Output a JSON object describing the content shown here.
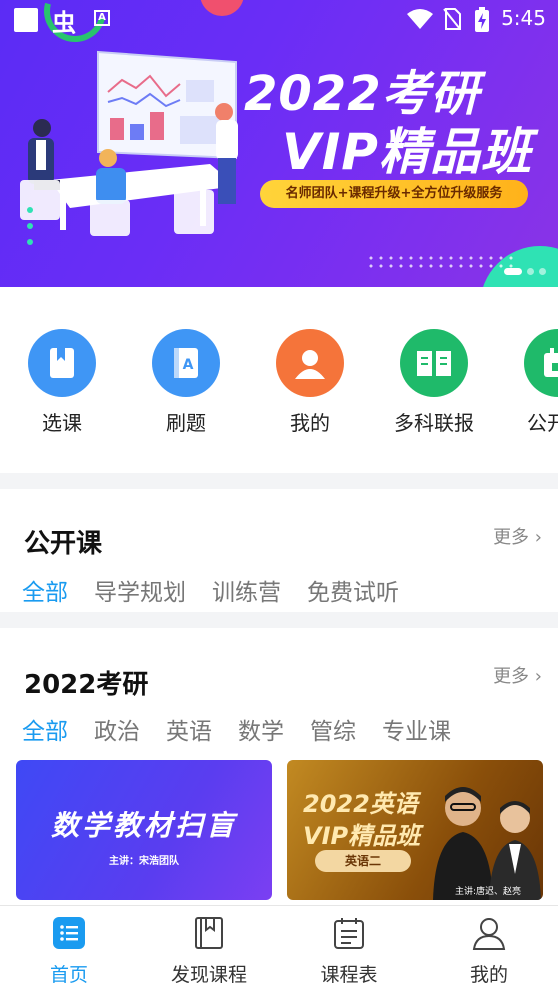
{
  "status_bar": {
    "time": "5:45"
  },
  "banner": {
    "title_line1": "2022考研",
    "title_line2": "VIP精品班",
    "tagline": "名师团队+课程升级+全方位升级服务",
    "colors": {
      "bg": "#6a2df6",
      "pill": "#ffc52a"
    }
  },
  "quick_nav": [
    {
      "label": "选课",
      "icon": "book-icon",
      "color": "#3f96f5"
    },
    {
      "label": "刷题",
      "icon": "exercise-book-icon",
      "color": "#3f96f5"
    },
    {
      "label": "我的",
      "icon": "user-icon",
      "color": "#f5743a"
    },
    {
      "label": "多科联报",
      "icon": "open-book-icon",
      "color": "#1fba6a"
    },
    {
      "label": "公开",
      "icon": "calendar-icon",
      "color": "#1fba6a"
    }
  ],
  "open_courses": {
    "title": "公开课",
    "more": "更多",
    "tabs": [
      "全部",
      "导学规划",
      "训练营",
      "免费试听"
    ]
  },
  "exam2022": {
    "title": "2022考研",
    "more": "更多",
    "tabs": [
      "全部",
      "政治",
      "英语",
      "数学",
      "管综",
      "专业课"
    ],
    "cards": [
      {
        "title": "数学教材扫盲",
        "lecturer": "主讲：宋浩团队"
      },
      {
        "title_line1": "2022英语",
        "title_line2": "VIP精品班",
        "badge": "英语二",
        "lecturer": "主讲:唐迟、赵亮"
      }
    ]
  },
  "tab_bar": {
    "items": [
      {
        "label": "首页",
        "icon": "home-list-icon",
        "active": true
      },
      {
        "label": "发现课程",
        "icon": "bookmark-book-icon",
        "active": false
      },
      {
        "label": "课程表",
        "icon": "clipboard-icon",
        "active": false
      },
      {
        "label": "我的",
        "icon": "profile-icon",
        "active": false
      }
    ],
    "accent": "#1a9bf0"
  }
}
